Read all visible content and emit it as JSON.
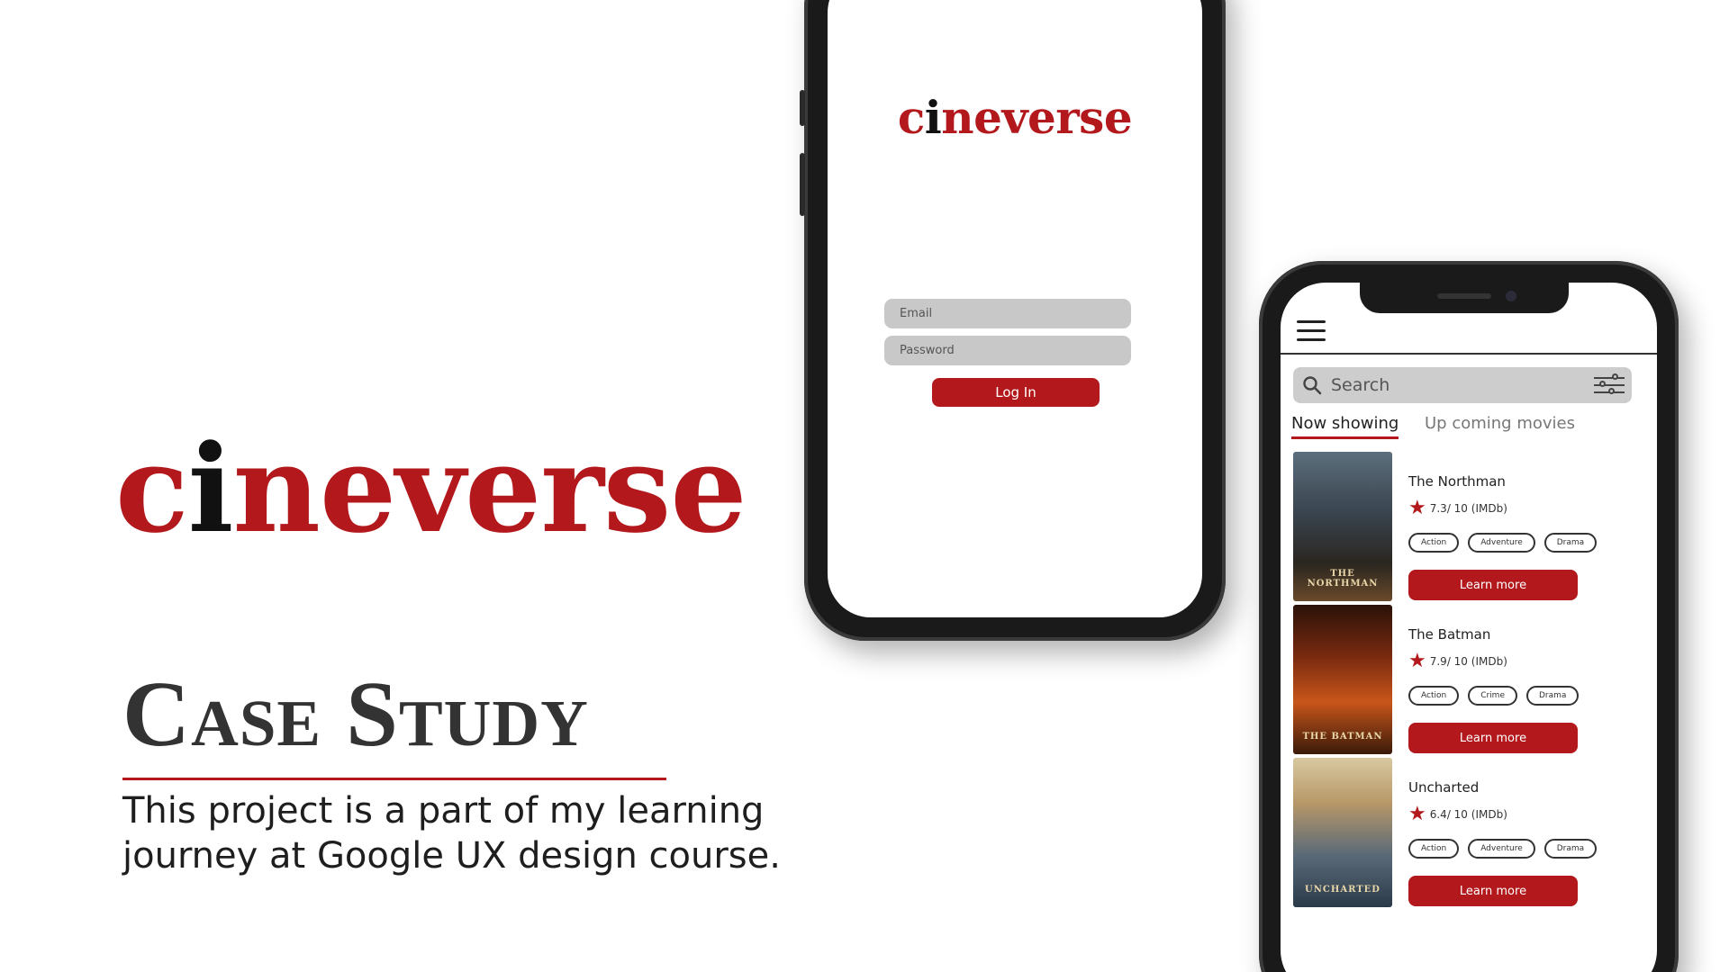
{
  "brand": {
    "prefix": "c",
    "i": "i",
    "suffix": "neverse"
  },
  "case_study": {
    "title": "Case Study",
    "description": "This project is a part of my learning journey at Google UX design course."
  },
  "login_screen": {
    "logo": {
      "prefix": "c",
      "i": "i",
      "suffix": "neverse"
    },
    "email_placeholder": "Email",
    "password_placeholder": "Password",
    "login_label": "Log In"
  },
  "list_screen": {
    "search_placeholder": "Search",
    "tabs": [
      {
        "label": "Now showing",
        "active": true
      },
      {
        "label": "Up coming movies",
        "active": false
      }
    ],
    "movies": [
      {
        "title": "The Northman",
        "rating": "7.3/ 10 (IMDb)",
        "genres": [
          "Action",
          "Adventure",
          "Drama"
        ],
        "button": "Learn more",
        "poster_text": "THE NORTHMAN"
      },
      {
        "title": "The Batman",
        "rating": "7.9/ 10 (IMDb)",
        "genres": [
          "Action",
          "Crime",
          "Drama"
        ],
        "button": "Learn more",
        "poster_text": "THE BATMAN"
      },
      {
        "title": "Uncharted",
        "rating": "6.4/ 10 (IMDb)",
        "genres": [
          "Action",
          "Adventure",
          "Drama"
        ],
        "button": "Learn more",
        "poster_text": "UNCHARTED"
      }
    ]
  },
  "colors": {
    "accent": "#b3191c",
    "dark": "#1a1a1a",
    "input_bg": "#c8c8c8"
  },
  "icons": [
    "search-icon",
    "hamburger-menu-icon",
    "filter-sliders-icon",
    "star-icon"
  ]
}
